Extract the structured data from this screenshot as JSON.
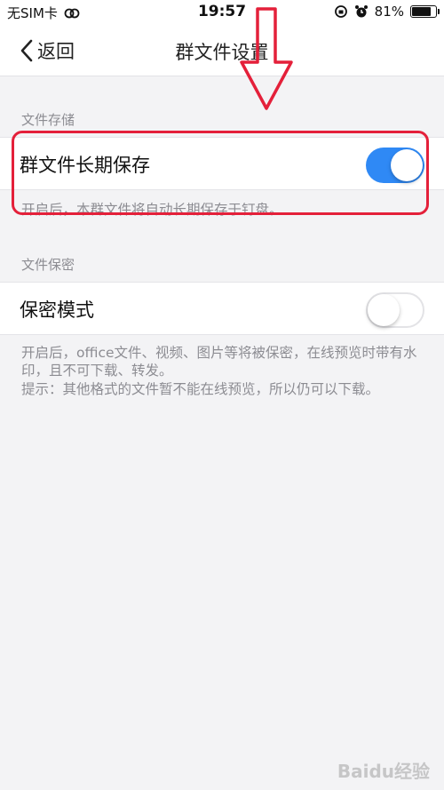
{
  "status_bar": {
    "carrier": "无SIM卡",
    "time": "19:57",
    "battery_pct": "81%",
    "battery_level": 0.81
  },
  "nav": {
    "back_label": "返回",
    "title": "群文件设置"
  },
  "sections": {
    "storage": {
      "header": "文件存储",
      "row_label": "群文件长期保存",
      "toggle_on": true,
      "note": "开启后，本群文件将自动长期保存于钉盘。"
    },
    "privacy": {
      "header": "文件保密",
      "row_label": "保密模式",
      "toggle_on": false,
      "note_line1": "开启后，office文件、视频、图片等将被保密，在线预览时带有水印，且不可下载、转发。",
      "note_line2": "提示：其他格式的文件暂不能在线预览，所以仍可以下载。"
    }
  },
  "colors": {
    "accent": "#2f89f5",
    "annotation": "#e4203a"
  },
  "watermark": "Baidu经验"
}
